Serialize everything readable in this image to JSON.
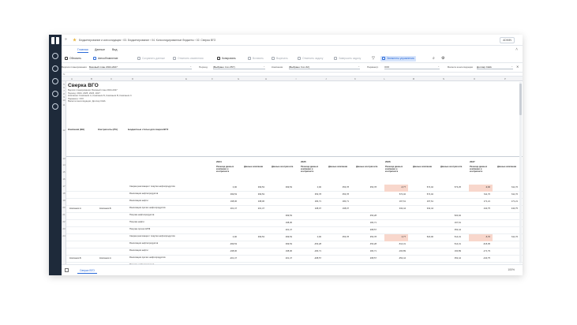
{
  "topbar": {
    "breadcrumb": "Бюджетирование и консолидация › 03. Бюджетирование › 04. Консолидированные бюджеты › 02. Сверка ВГО",
    "user": "ADMIN"
  },
  "menu": {
    "tabs": [
      "Главная",
      "Данные",
      "Вид"
    ]
  },
  "toolbar": {
    "items": [
      "Обновить",
      "Автообновление",
      "Сохранить данные",
      "Отменить изменения",
      "Копировать",
      "Вставить",
      "Вырезать",
      "Отменить задачу",
      "Завершить задачу",
      "",
      "Элементы управления",
      "",
      ""
    ]
  },
  "filters": [
    {
      "label": "Версия планирования",
      "value": "Базовый план 2024-2027"
    },
    {
      "label": "Период",
      "value": "(Выбрано 4 из 357)"
    },
    {
      "label": "Компания",
      "value": "(Выбрано 3 из 32)"
    },
    {
      "label": "Параметр",
      "value": "XXX"
    },
    {
      "label": "Валюта консолидации",
      "value": "Доллар США"
    }
  ],
  "sheet": {
    "columns": [
      "A",
      "B",
      "C",
      "D",
      "E",
      "F",
      "G",
      "H",
      "I",
      "J",
      "K",
      "L",
      "M",
      "N",
      "O",
      "P"
    ],
    "title": "Сверка ВГО",
    "info": [
      "Версия планирования: Базовый план 2024-2027",
      "Период: 2024, 2025, 2026, 2027",
      "Компании: Компания А, Компания Б, Компания В, Компания С",
      "Параметр: XXX",
      "Валюта консолидации: Доллар США"
    ],
    "group_headers": [
      "Компания (ВН)",
      "Контрагенты (РА)",
      "Бюджетные статьи для сверки ВГО"
    ],
    "years": [
      "2024",
      "2025",
      "2026",
      "2027"
    ],
    "subheaders": [
      "Разница данных компании и контрагента",
      "Данные компании",
      "Данные контрагента"
    ],
    "row_numbers": [
      "5",
      "6",
      "7",
      "8",
      "9",
      "10",
      "11",
      "12",
      "13",
      "14",
      "15",
      "16",
      "17",
      "18",
      "19",
      "20",
      "21",
      "22",
      "23",
      "24"
    ],
    "rows": [
      {
        "company": "",
        "partner": "",
        "item": "Сверка реализации / покупки нефтепродуктов",
        "vals": [
          "0,00",
          "399,53",
          "399,53",
          "0,00",
          "353,78",
          "353,78",
          "-0,77",
          "574,02",
          "573,25",
          "-9,00",
          "611,76",
          "617,57"
        ]
      },
      {
        "company": "",
        "partner": "",
        "item": "Реализация нефтепродуктов",
        "vals": [
          "399,53",
          "399,53",
          "",
          "353,78",
          "353,78",
          "",
          "574,02",
          "574,02",
          "",
          "611,76",
          "611,76",
          ""
        ]
      },
      {
        "company": "",
        "partner": "",
        "item": "Реализация нефти",
        "vals": [
          "198,06",
          "198,06",
          "",
          "184,71",
          "184,71",
          "",
          "167,61",
          "167,61",
          "",
          "171,21",
          "171,21",
          ""
        ]
      },
      {
        "company": "Компания А",
        "partner": "Компания Б",
        "item": "Реализация прочих нефтепродуктов",
        "vals": [
          "201,47",
          "201,47",
          "",
          "168,07",
          "168,07",
          "",
          "332,44",
          "332,44",
          "",
          "440,75",
          "440,75",
          ""
        ]
      },
      {
        "company": "",
        "partner": "",
        "item": "Покупка нефтепродуктов",
        "vals": [
          "",
          "",
          "399,53",
          "",
          "",
          "453,28",
          "",
          "",
          "520,02",
          "",
          "",
          "622,07"
        ]
      },
      {
        "company": "",
        "partner": "",
        "item": "Покупка нефти",
        "vals": [
          "",
          "",
          "198,06",
          "",
          "",
          "184,71",
          "",
          "",
          "167,61",
          "",
          "",
          "181,21"
        ]
      },
      {
        "company": "",
        "partner": "",
        "item": "Покупка прочих НПФ",
        "vals": [
          "",
          "",
          "201,47",
          "",
          "",
          "268,57",
          "",
          "",
          "352,44",
          "",
          "",
          "440,75"
        ]
      },
      {
        "company": "",
        "partner": "",
        "item": "Сверка реализации / покупки нефтепродуктов",
        "vals": [
          "0,00",
          "399,53",
          "399,53",
          "0,00",
          "353,78",
          "353,78",
          "0,77",
          "520,00",
          "514,31",
          "-5,70",
          "611,76",
          "615,05"
        ]
      },
      {
        "company": "",
        "partner": "",
        "item": "Реализация нефтепродуктов",
        "vals": [
          "-399,53",
          "",
          "399,53",
          "-453,28",
          "",
          "453,28",
          "-514,31",
          "",
          "514,31",
          "-615,05",
          "",
          "615,05"
        ]
      },
      {
        "company": "",
        "partner": "",
        "item": "Реализация нефти",
        "vals": [
          "-198,06",
          "",
          "198,06",
          "-184,71",
          "",
          "184,71",
          "-160,89",
          "",
          "160,89",
          "-171,79",
          "",
          "171,79"
        ]
      },
      {
        "company": "Компания Б",
        "partner": "Компания А",
        "item": "Реализация прочих нефтепродуктов",
        "vals": [
          "-201,47",
          "",
          "201,47",
          "-268,57",
          "",
          "268,57",
          "-352,44",
          "",
          "352,44",
          "-440,75",
          "",
          "440,75"
        ]
      },
      {
        "company": "",
        "partner": "",
        "item": "Покупка нефтепродуктов",
        "vals": [
          "399,53",
          "399,53",
          "",
          "453,28",
          "453,28",
          "",
          "520,02",
          "520,02",
          "",
          "622,07",
          "622,07",
          ""
        ]
      },
      {
        "company": "",
        "partner": "",
        "item": "Покупка нефти",
        "vals": [
          "198,06",
          "198,06",
          "",
          "184,71",
          "184,71",
          "",
          "167,61",
          "167,61",
          "",
          "181,21",
          "181,21",
          ""
        ]
      },
      {
        "company": "",
        "partner": "",
        "item": "Покупка прочих НПФ",
        "vals": [
          "201,47",
          "201,47",
          "",
          "268,57",
          "268,57",
          "",
          "352,44",
          "352,44",
          "",
          "440,75",
          "440,75",
          ""
        ]
      }
    ]
  },
  "status": {
    "sheet_tab": "Сверка ВГО",
    "zoom": "100%"
  }
}
